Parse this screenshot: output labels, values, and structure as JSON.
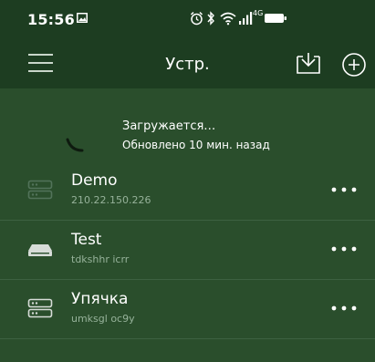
{
  "status_bar": {
    "time": "15:56",
    "network_label": "4G"
  },
  "toolbar": {
    "title": "Устр."
  },
  "refresh": {
    "loading_text": "Загружается…",
    "updated_text": "Обновлено 10 мин. назад"
  },
  "devices": [
    {
      "name": "Demo",
      "subtitle": "210.22.150.226",
      "icon": "server-icon",
      "state": "disabled"
    },
    {
      "name": "Test",
      "subtitle": "tdkshhr    icrr",
      "icon": "router-icon",
      "state": "active"
    },
    {
      "name": "Упячка",
      "subtitle": "umksgl    oc9y",
      "icon": "server-icon",
      "state": "active"
    }
  ],
  "colors": {
    "status_bar_bg": "#1d3d21",
    "content_bg": "#2a4e2c",
    "subtitle": "#96b29a"
  }
}
